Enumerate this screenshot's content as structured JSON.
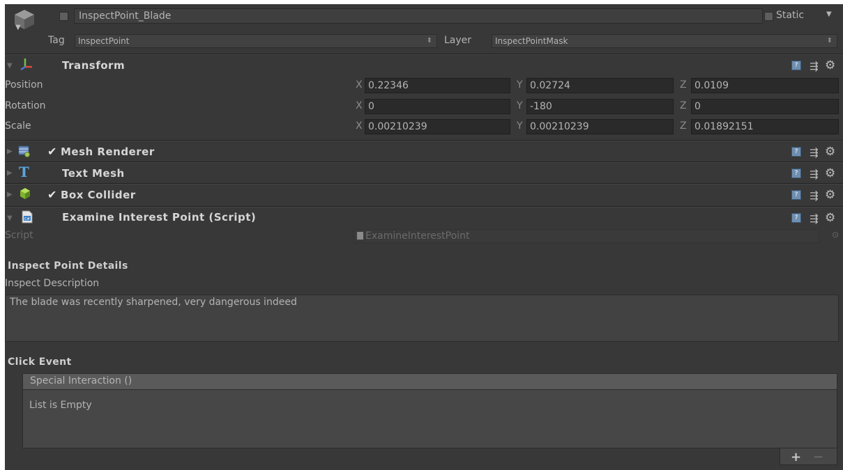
{
  "header": {
    "object_name": "InspectPoint_Blade",
    "static_label": "Static",
    "tag_label": "Tag",
    "tag_value": "InspectPoint",
    "layer_label": "Layer",
    "layer_value": "InspectPointMask"
  },
  "transform": {
    "title": "Transform",
    "rows": [
      {
        "label": "Position",
        "x": "0.22346",
        "y": "0.02724",
        "z": "0.0109"
      },
      {
        "label": "Rotation",
        "x": "0",
        "y": "-180",
        "z": "0"
      },
      {
        "label": "Scale",
        "x": "0.00210239",
        "y": "0.00210239",
        "z": "0.01892151"
      }
    ],
    "axis_x": "X",
    "axis_y": "Y",
    "axis_z": "Z"
  },
  "components": {
    "mesh_renderer": "Mesh Renderer",
    "text_mesh": "Text Mesh",
    "box_collider": "Box Collider"
  },
  "script_component": {
    "title": "Examine Interest Point (Script)",
    "script_label": "Script",
    "script_value": "ExamineInterestPoint",
    "section_details": "Inspect Point Details",
    "description_label": "Inspect Description",
    "description_value": "The blade was recently sharpened, very dangerous indeed",
    "section_click": "Click Event",
    "event_header": "Special Interaction ()",
    "event_empty": "List is Empty",
    "add_label": "+",
    "remove_label": "−"
  },
  "icons": {
    "gameobject": "gameobject-cube-icon",
    "transform": "transform-axes-icon",
    "mesh_renderer": "mesh-renderer-icon",
    "text_mesh": "text-mesh-T-icon",
    "box_collider": "box-collider-icon",
    "script": "csharp-script-icon"
  },
  "colors": {
    "panel_bg": "#383838",
    "field_bg": "#2a2a2a",
    "text": "#b4b4b4",
    "title_text": "#d6d6d6"
  }
}
